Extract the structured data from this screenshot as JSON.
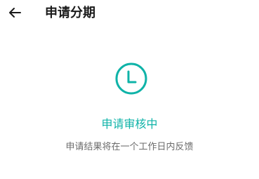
{
  "header": {
    "title": "申请分期",
    "back_icon": "arrow-left-icon"
  },
  "status": {
    "icon": "clock-icon",
    "title": "申请审核中",
    "description": "申请结果将在一个工作日内反馈"
  },
  "colors": {
    "accent": "#0fb3a8",
    "title_text": "#1a1a1a",
    "desc_text": "#6b6b6b",
    "background": "#ffffff"
  }
}
